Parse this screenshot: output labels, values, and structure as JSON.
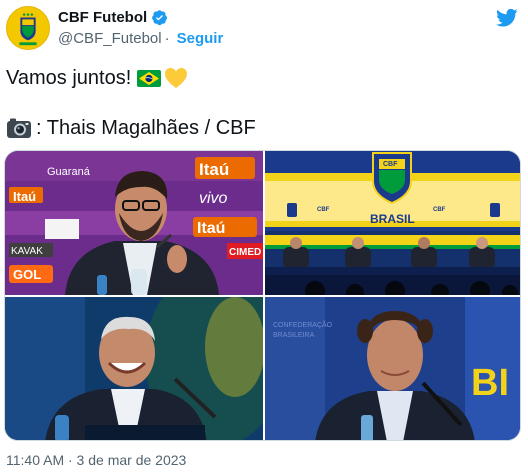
{
  "author": {
    "display_name": "CBF Futebol",
    "handle": "@CBF_Futebol",
    "separator": "·",
    "follow_label": "Seguir",
    "avatar_icon": "cbf-crest-icon",
    "verified_icon": "verified-badge-icon",
    "logo_icon": "twitter-bird-icon"
  },
  "tweet": {
    "line1": "Vamos juntos!",
    "line1_emojis": [
      "brazil-flag-icon",
      "yellow-heart-icon"
    ],
    "line2": ": Thais Magalhães / CBF",
    "line2_emoji": "camera-icon"
  },
  "media": {
    "photos": [
      {
        "name": "photo-speaker-glasses",
        "banner_words": [
          "Itaú",
          "vivo",
          "Guaraná",
          "KAVAK",
          "GOL",
          "CIMED"
        ]
      },
      {
        "name": "photo-press-conference",
        "banner_words": [
          "CBF",
          "BRASIL"
        ]
      },
      {
        "name": "photo-smiling-official"
      },
      {
        "name": "photo-man-microphone",
        "banner_words": [
          "BI"
        ]
      }
    ]
  },
  "timestamp": "11:40 AM · 3 de mar de 2023",
  "colors": {
    "accent": "#1d9bf0",
    "text": "#0f1419",
    "muted": "#536471",
    "cbf_yellow": "#f3c800",
    "cbf_green": "#009c3b",
    "cbf_blue": "#1b3a8c"
  }
}
